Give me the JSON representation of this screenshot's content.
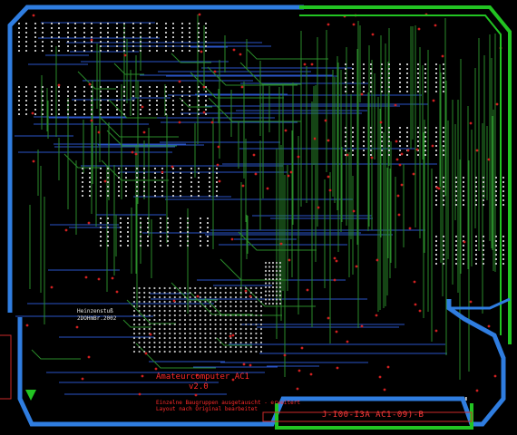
{
  "board": {
    "title": "Amateurcomputer AC1",
    "version": "v2.0",
    "board_id": "J-I00-I3A AC1-09)-B",
    "author": "Heinzenstuß",
    "date": "2DOHmBr.2002",
    "note": "Einzelne Baugruppen ausgetauscht - erweitert",
    "note2": "Layout nach Original bearbeitet"
  },
  "colors": {
    "background": "#000000",
    "top_copper": "#2a8a2a",
    "bottom_copper": "#2a55c8",
    "outline": "#2f7de0",
    "outline_right": "#22c422",
    "silkscreen": "#e8e8e8",
    "pads": "#c0c0c0",
    "vias": "#d02020",
    "labels": "#ff2a2a"
  }
}
